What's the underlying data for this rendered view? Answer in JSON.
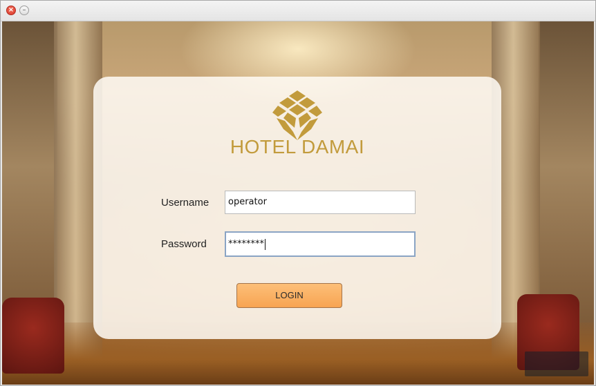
{
  "window": {
    "close_glyph": "×",
    "minimize_glyph": "–"
  },
  "brand": {
    "name": "HOTEL DAMAI",
    "color": "#c29b3c"
  },
  "form": {
    "username_label": "Username",
    "username_value": "operator",
    "password_label": "Password",
    "password_value": "********",
    "login_label": "LOGIN"
  },
  "colors": {
    "login_button": "#f7a452",
    "focus_border": "#8aa4c4"
  }
}
